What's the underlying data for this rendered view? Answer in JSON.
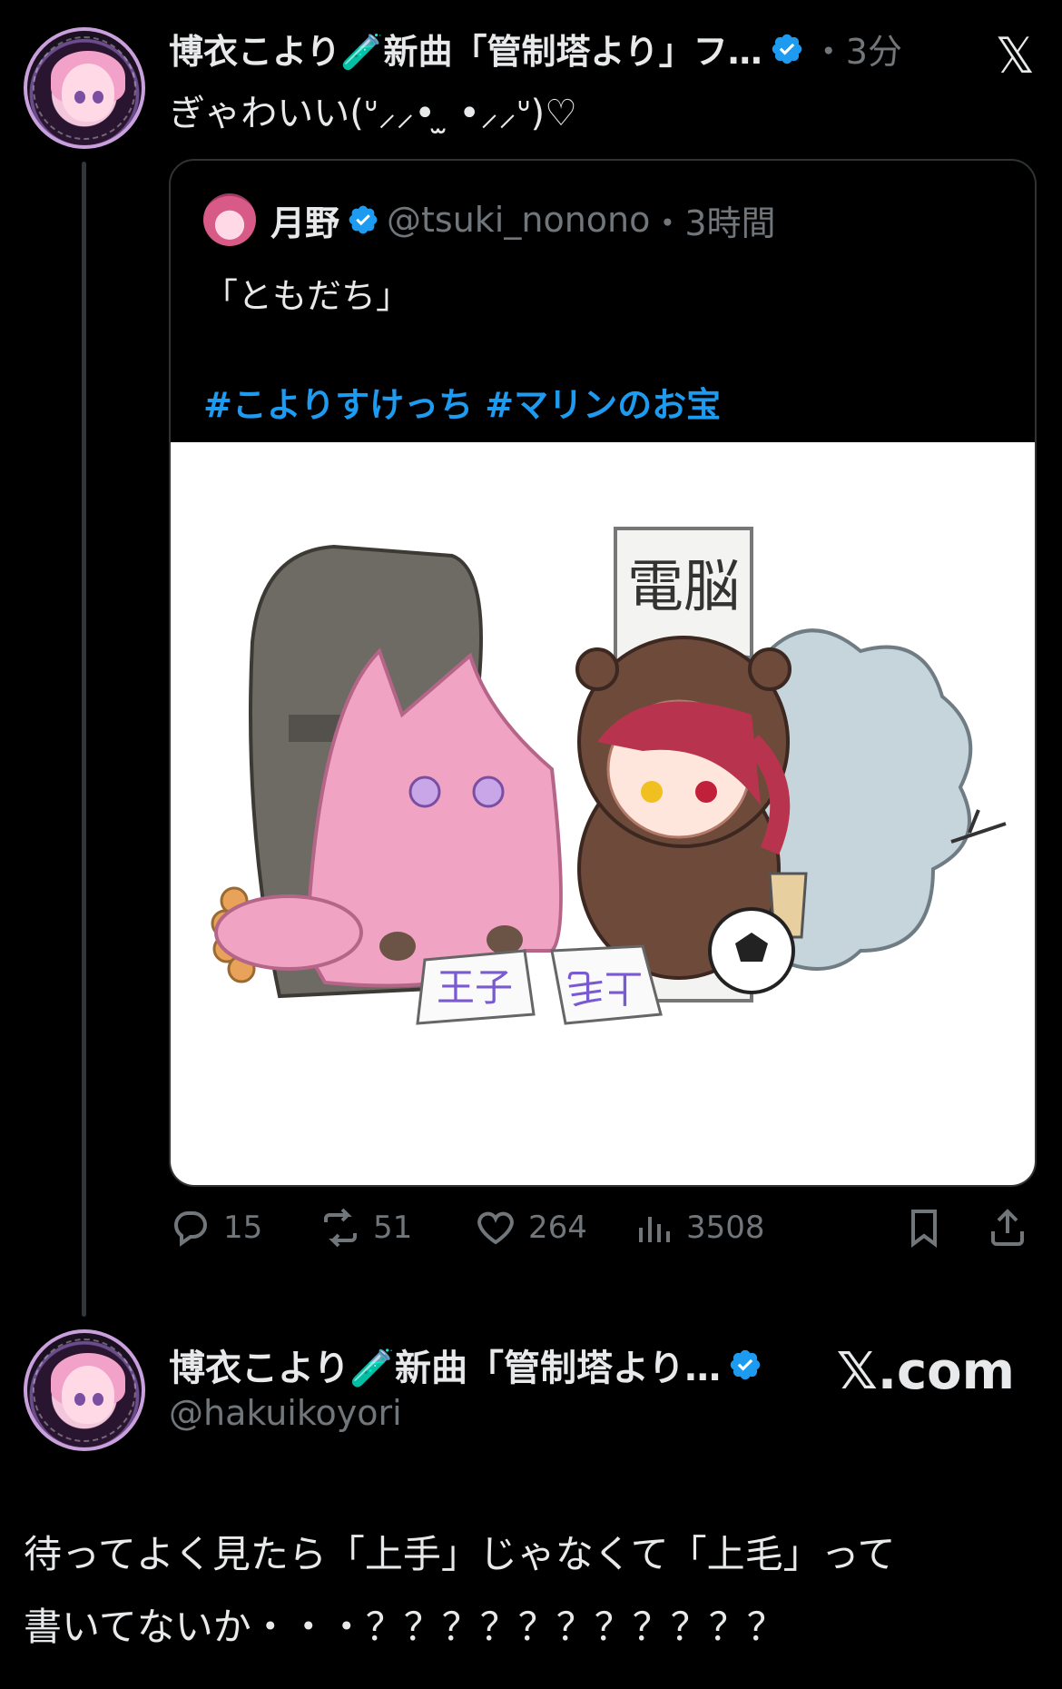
{
  "post": {
    "author_name": "博衣こより🧪新曲「管制塔より」フ…",
    "time": "・3分",
    "text": "ぎゃわいい(ᐡ⸝⸝• ̫ •⸝⸝ᐡ)♡"
  },
  "quote": {
    "author_name": "月野",
    "handle": "@tsuki_nonono",
    "time": "・3時間",
    "text": "「ともだち」",
    "hashtags": "#こよりすけっち #マリンのお宝"
  },
  "illustration": {
    "sign_text": "電脳",
    "paper_left": "王子",
    "paper_right": "上毛"
  },
  "actions": {
    "replies": "15",
    "reposts": "51",
    "likes": "264",
    "views": "3508"
  },
  "card": {
    "name": "博衣こより🧪新曲「管制塔より…",
    "handle": "@hakuikoyori",
    "domain": "𝕏.com"
  },
  "body": {
    "line1": "待ってよく見たら「上手」じゃなくて「上毛」って",
    "line2": "書いてないか・・・？？？？？？？？？？？"
  },
  "colors": {
    "background": "#000000",
    "accent": "#1d9bf0",
    "muted": "#71767b",
    "text": "#e7e9ea"
  }
}
